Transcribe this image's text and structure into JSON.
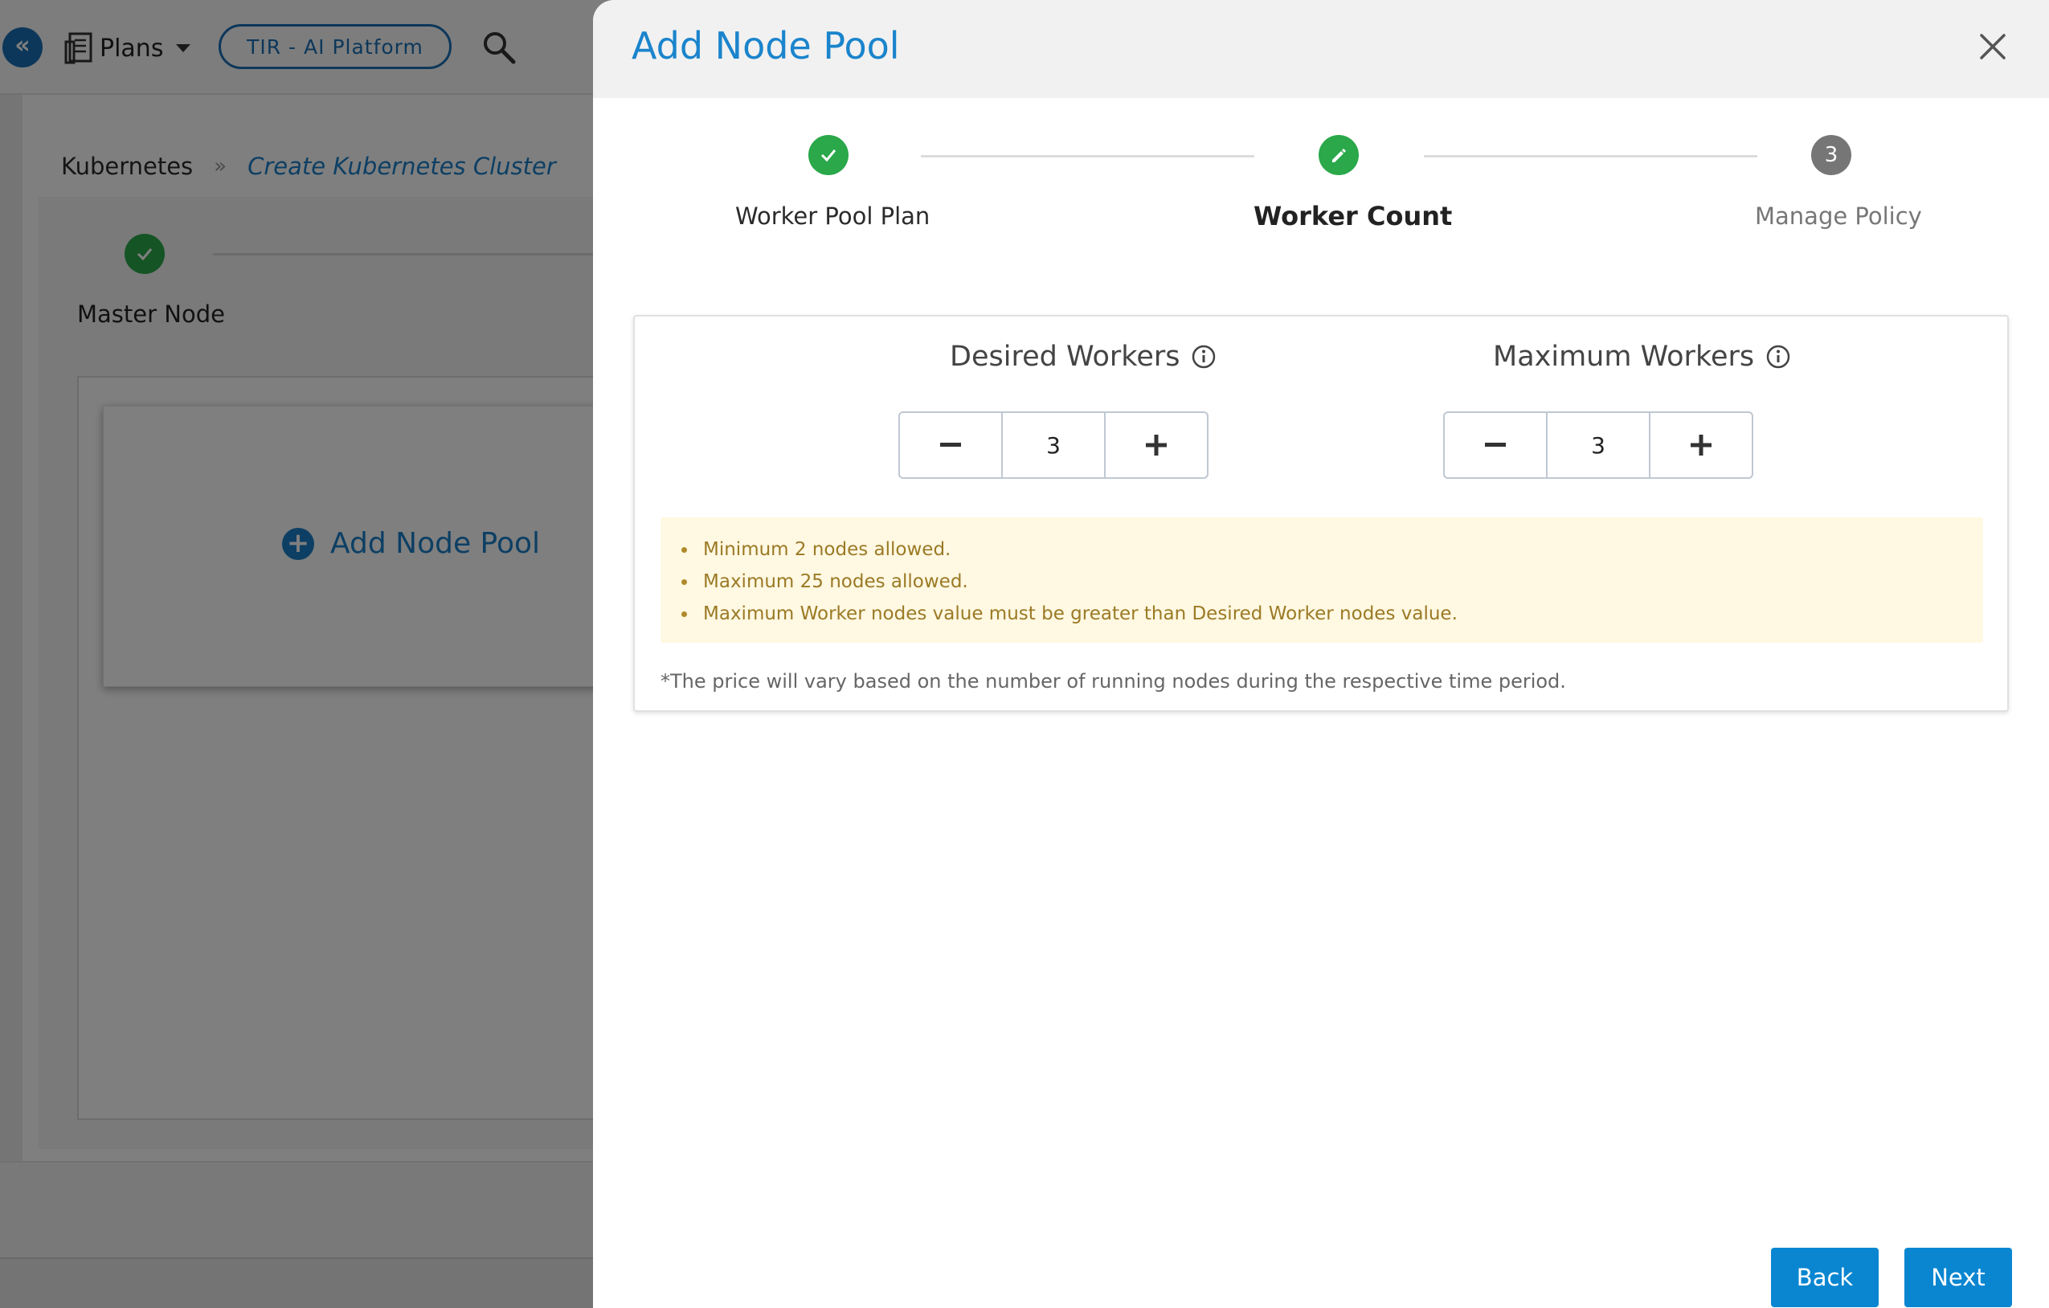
{
  "topbar": {
    "plans_label": "Plans",
    "platform_pill": "TIR - AI Platform"
  },
  "breadcrumb": {
    "root": "Kubernetes",
    "separator": "»",
    "current": "Create Kubernetes Cluster"
  },
  "background_page": {
    "step_label": "Master Node",
    "add_node_pool_label": "Add Node Pool"
  },
  "drawer": {
    "title": "Add Node Pool",
    "steps": [
      {
        "label": "Worker Pool Plan",
        "state": "done"
      },
      {
        "label": "Worker Count",
        "state": "active"
      },
      {
        "label": "Manage Policy",
        "state": "pending",
        "number": "3"
      }
    ],
    "desired_workers": {
      "label": "Desired Workers",
      "value": "3",
      "decrement": "−",
      "increment": "+"
    },
    "maximum_workers": {
      "label": "Maximum Workers",
      "value": "3",
      "decrement": "−",
      "increment": "+"
    },
    "notes": [
      "Minimum 2 nodes allowed.",
      "Maximum 25 nodes allowed.",
      "Maximum Worker nodes value must be greater than Desired Worker nodes value."
    ],
    "price_note": "*The price will vary based on the number of running nodes during the respective time period.",
    "back_label": "Back",
    "next_label": "Next"
  },
  "colors": {
    "accent": "#1a84cc",
    "success": "#2aa84a",
    "pending": "#767676",
    "warning_bg": "#fff8e2",
    "warning_text": "#9a7a25",
    "primary_button": "#0a86d1"
  }
}
